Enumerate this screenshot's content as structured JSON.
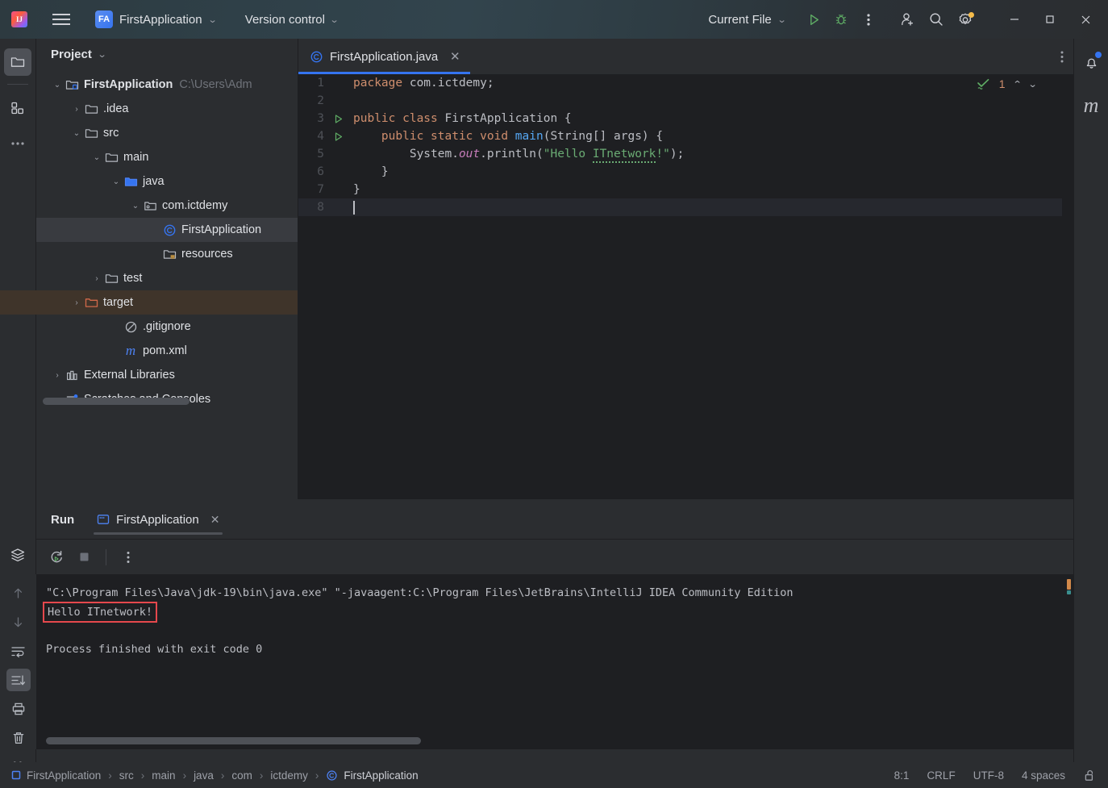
{
  "titlebar": {
    "logo_icon": "intellij-logo-icon",
    "logo_text": "IJ",
    "menu_icon": "hamburger-menu-icon",
    "project_badge": "FA",
    "project_name": "FirstApplication",
    "project_chevron": "chevron-down-icon",
    "version_control": "Version control",
    "vcs_chevron": "chevron-down-icon",
    "run_config": "Current File",
    "run_config_chevron": "chevron-down-icon",
    "run_icon": "run-play-icon",
    "debug_icon": "debug-bug-icon",
    "more_icon": "more-vertical-icon",
    "account_icon": "user-add-icon",
    "search_icon": "search-icon",
    "settings_icon": "gear-icon",
    "minimize_icon": "minimize-icon",
    "maximize_icon": "maximize-icon",
    "close_icon": "close-icon"
  },
  "left_rail": {
    "top": [
      {
        "name": "project-tool-icon",
        "active": true
      },
      {
        "name": "structure-tool-icon",
        "active": false
      },
      {
        "name": "more-tools-icon",
        "active": false
      }
    ],
    "bottom": [
      {
        "name": "services-layers-icon",
        "active": false
      },
      {
        "name": "run-dashboard-icon",
        "active": false
      },
      {
        "name": "build-hammer-icon",
        "active": false
      },
      {
        "name": "run-tool-icon",
        "active": true
      },
      {
        "name": "terminal-icon",
        "active": false
      },
      {
        "name": "problems-icon",
        "active": false
      },
      {
        "name": "git-branch-icon",
        "active": false
      }
    ]
  },
  "project_panel": {
    "title": "Project",
    "title_chevron": "chevron-down-icon",
    "tree": [
      {
        "label": "FirstApplication",
        "suffix": "C:\\Users\\Adm",
        "icon": "module-folder-icon",
        "arrow": "expanded",
        "indent": 0,
        "bold": true,
        "selected": false
      },
      {
        "label": ".idea",
        "suffix": "",
        "icon": "folder-icon",
        "arrow": "collapsed",
        "indent": 1,
        "bold": false,
        "selected": false
      },
      {
        "label": "src",
        "suffix": "",
        "icon": "folder-icon",
        "arrow": "expanded",
        "indent": 1,
        "bold": false,
        "selected": false
      },
      {
        "label": "main",
        "suffix": "",
        "icon": "folder-icon",
        "arrow": "expanded",
        "indent": 2,
        "bold": false,
        "selected": false
      },
      {
        "label": "java",
        "suffix": "",
        "icon": "source-folder-icon",
        "arrow": "expanded",
        "indent": 3,
        "bold": false,
        "selected": false
      },
      {
        "label": "com.ictdemy",
        "suffix": "",
        "icon": "package-icon",
        "arrow": "expanded",
        "indent": 4,
        "bold": false,
        "selected": false
      },
      {
        "label": "FirstApplication",
        "suffix": "",
        "icon": "java-class-icon",
        "arrow": "none",
        "indent": 5,
        "bold": false,
        "selected": true
      },
      {
        "label": "resources",
        "suffix": "",
        "icon": "resources-folder-icon",
        "arrow": "none",
        "indent": 4,
        "bold": false,
        "selected": false
      },
      {
        "label": "test",
        "suffix": "",
        "icon": "folder-icon",
        "arrow": "collapsed",
        "indent": 2,
        "bold": false,
        "selected": false
      },
      {
        "label": "target",
        "suffix": "",
        "icon": "excluded-folder-icon",
        "arrow": "collapsed",
        "indent": 1,
        "bold": false,
        "selected": false,
        "highlight": true
      },
      {
        "label": ".gitignore",
        "suffix": "",
        "icon": "gitignore-icon",
        "arrow": "none",
        "indent": 2,
        "bold": false,
        "selected": false
      },
      {
        "label": "pom.xml",
        "suffix": "",
        "icon": "maven-icon",
        "arrow": "none",
        "indent": 2,
        "bold": false,
        "selected": false
      },
      {
        "label": "External Libraries",
        "suffix": "",
        "icon": "libraries-icon",
        "arrow": "collapsed",
        "indent": 0,
        "bold": false,
        "selected": false
      },
      {
        "label": "Scratches and Consoles",
        "suffix": "",
        "icon": "scratches-icon",
        "arrow": "collapsed",
        "indent": 0,
        "bold": false,
        "selected": false
      }
    ]
  },
  "editor": {
    "tab": {
      "label": "FirstApplication.java",
      "icon": "java-class-icon",
      "close_icon": "close-icon"
    },
    "tab_options_icon": "more-vertical-icon",
    "inspection": {
      "status_icon": "inspections-ok-icon",
      "count": "1",
      "up_icon": "chevron-up-icon",
      "down_icon": "chevron-down-icon"
    },
    "lines": [
      {
        "no": "1",
        "gutter_icon": "",
        "current": false
      },
      {
        "no": "2",
        "gutter_icon": "",
        "current": false
      },
      {
        "no": "3",
        "gutter_icon": "run-gutter-icon",
        "current": false
      },
      {
        "no": "4",
        "gutter_icon": "run-gutter-icon",
        "current": false
      },
      {
        "no": "5",
        "gutter_icon": "",
        "current": false
      },
      {
        "no": "6",
        "gutter_icon": "",
        "current": false
      },
      {
        "no": "7",
        "gutter_icon": "",
        "current": false
      },
      {
        "no": "8",
        "gutter_icon": "",
        "current": true
      }
    ],
    "code_text": {
      "l1_kw": "package",
      "l1_rest": " com.ictdemy;",
      "l3_a": "public class ",
      "l3_b": "FirstApplication {",
      "l4_a": "    public static void ",
      "l4_b": "main",
      "l4_c": "(String[] args) {",
      "l5_a": "        System.",
      "l5_b": "out",
      "l5_c": ".println(",
      "l5_str_open": "\"Hello ",
      "l5_str_wavy": "ITnetwork",
      "l5_str_close": "!\"",
      "l5_d": ");",
      "l6": "    }",
      "l7": "}"
    }
  },
  "run_panel": {
    "title": "Run",
    "tab_label": "FirstApplication",
    "tab_icon": "console-icon",
    "tab_close_icon": "close-icon",
    "toolbar": [
      {
        "name": "rerun-icon"
      },
      {
        "name": "stop-icon"
      },
      {
        "name": "more-vertical-icon"
      }
    ],
    "console_rail": [
      {
        "name": "scroll-up-icon",
        "active": false
      },
      {
        "name": "scroll-down-icon",
        "active": false
      },
      {
        "name": "soft-wrap-icon",
        "active": false
      },
      {
        "name": "scroll-to-end-icon",
        "active": true
      },
      {
        "name": "print-icon",
        "active": false
      },
      {
        "name": "clear-all-trash-icon",
        "active": false
      }
    ],
    "console_lines": {
      "command": "\"C:\\Program Files\\Java\\jdk-19\\bin\\java.exe\" \"-javaagent:C:\\Program Files\\JetBrains\\IntelliJ IDEA Community Edition",
      "output": "Hello ITnetwork!",
      "finished": "Process finished with exit code 0"
    }
  },
  "right_rail": {
    "notifications_icon": "bell-icon",
    "maven_icon": "maven-m-icon"
  },
  "status_bar": {
    "breadcrumb": [
      {
        "label": "FirstApplication",
        "icon": "module-icon"
      },
      {
        "label": "src",
        "icon": ""
      },
      {
        "label": "main",
        "icon": ""
      },
      {
        "label": "java",
        "icon": ""
      },
      {
        "label": "com",
        "icon": ""
      },
      {
        "label": "ictdemy",
        "icon": ""
      },
      {
        "label": "FirstApplication",
        "icon": "java-class-icon"
      }
    ],
    "caret_position": "8:1",
    "line_separator": "CRLF",
    "encoding": "UTF-8",
    "indent": "4 spaces",
    "lock_icon": "unlocked-icon"
  },
  "colors": {
    "accent_blue": "#3574f0",
    "titlebar_teal": "#32444d",
    "panel_bg": "#2b2d30",
    "editor_bg": "#1e1f22",
    "selection": "#393b40",
    "target_highlight": "#3f342a",
    "highlight_red": "#e5484d",
    "string_green": "#6aab73",
    "keyword_orange": "#cf8e6d",
    "method_blue": "#56a8f5",
    "field_purple": "#c77dbb"
  }
}
